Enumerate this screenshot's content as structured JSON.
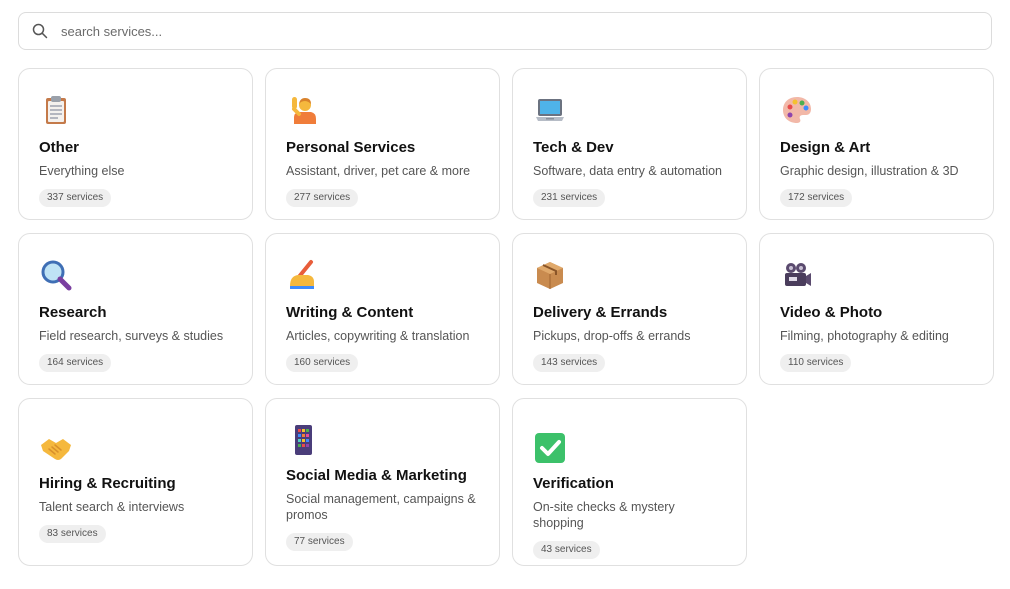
{
  "search": {
    "placeholder": "search services..."
  },
  "categories": [
    {
      "title": "Other",
      "description": "Everything else",
      "count": "337 services",
      "icon": "clipboard-icon"
    },
    {
      "title": "Personal Services",
      "description": "Assistant, driver, pet care & more",
      "count": "277 services",
      "icon": "person-raising-hand-icon"
    },
    {
      "title": "Tech & Dev",
      "description": "Software, data entry & automation",
      "count": "231 services",
      "icon": "laptop-icon"
    },
    {
      "title": "Design & Art",
      "description": "Graphic design, illustration & 3D",
      "count": "172 services",
      "icon": "palette-icon"
    },
    {
      "title": "Research",
      "description": "Field research, surveys & studies",
      "count": "164 services",
      "icon": "magnifying-glass-icon"
    },
    {
      "title": "Writing & Content",
      "description": "Articles, copywriting & translation",
      "count": "160 services",
      "icon": "writing-hand-icon"
    },
    {
      "title": "Delivery & Errands",
      "description": "Pickups, drop-offs & errands",
      "count": "143 services",
      "icon": "package-icon"
    },
    {
      "title": "Video & Photo",
      "description": "Filming, photography & editing",
      "count": "110 services",
      "icon": "movie-camera-icon"
    },
    {
      "title": "Hiring & Recruiting",
      "description": "Talent search & interviews",
      "count": "83 services",
      "icon": "handshake-icon"
    },
    {
      "title": "Social Media & Marketing",
      "description": "Social management, campaigns & promos",
      "count": "77 services",
      "icon": "mobile-phone-icon"
    },
    {
      "title": "Verification",
      "description": "On-site checks & mystery shopping",
      "count": "43 services",
      "icon": "check-mark-button-icon"
    }
  ]
}
